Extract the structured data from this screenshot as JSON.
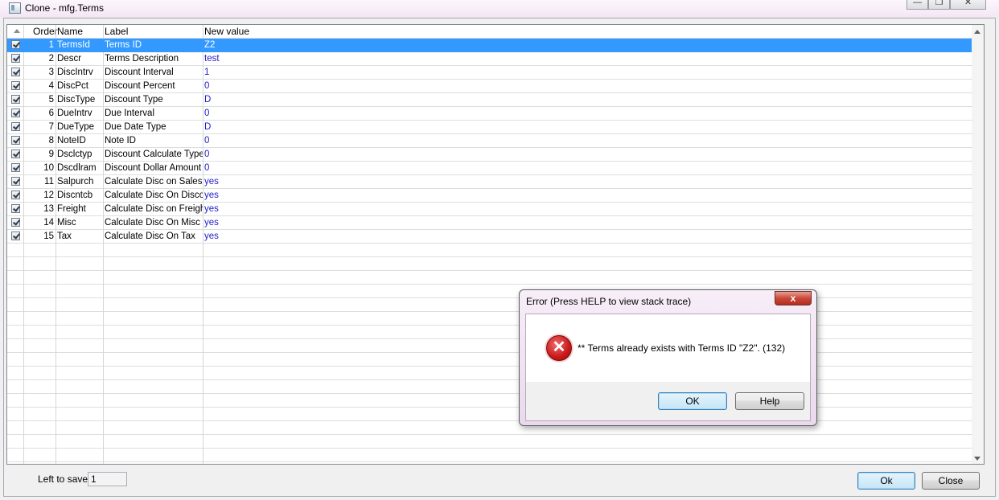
{
  "window": {
    "title": "Clone - mfg.Terms",
    "minimize_glyph": "—",
    "restore_glyph": "❐",
    "close_glyph": "✕"
  },
  "grid": {
    "columns": [
      "Order",
      "Name",
      "Label",
      "New value"
    ],
    "rows": [
      {
        "checked": true,
        "order": "1",
        "name": "TermsId",
        "label": "Terms ID",
        "value": "Z2",
        "selected": true
      },
      {
        "checked": true,
        "order": "2",
        "name": "Descr",
        "label": "Terms Description",
        "value": "test"
      },
      {
        "checked": true,
        "order": "3",
        "name": "DiscIntrv",
        "label": "Discount Interval",
        "value": "1"
      },
      {
        "checked": true,
        "order": "4",
        "name": "DiscPct",
        "label": "Discount Percent",
        "value": "0"
      },
      {
        "checked": true,
        "order": "5",
        "name": "DiscType",
        "label": "Discount Type",
        "value": "D"
      },
      {
        "checked": true,
        "order": "6",
        "name": "DueIntrv",
        "label": "Due Interval",
        "value": "0"
      },
      {
        "checked": true,
        "order": "7",
        "name": "DueType",
        "label": "Due Date Type",
        "value": "D"
      },
      {
        "checked": true,
        "order": "8",
        "name": "NoteID",
        "label": "Note ID",
        "value": "0"
      },
      {
        "checked": true,
        "order": "9",
        "name": "Dsclctyp",
        "label": "Discount Calculate Type",
        "value": "0"
      },
      {
        "checked": true,
        "order": "10",
        "name": "Dscdlram",
        "label": "Discount Dollar Amount",
        "value": "0"
      },
      {
        "checked": true,
        "order": "11",
        "name": "Salpurch",
        "label": "Calculate Disc on Sales",
        "value": "yes"
      },
      {
        "checked": true,
        "order": "12",
        "name": "Discntcb",
        "label": "Calculate Disc On Discou",
        "value": "yes"
      },
      {
        "checked": true,
        "order": "13",
        "name": "Freight",
        "label": "Calculate Disc on Freigh",
        "value": "yes"
      },
      {
        "checked": true,
        "order": "14",
        "name": "Misc",
        "label": "Calculate Disc On Misc",
        "value": "yes"
      },
      {
        "checked": true,
        "order": "15",
        "name": "Tax",
        "label": "Calculate Disc On Tax",
        "value": "yes"
      }
    ]
  },
  "footer": {
    "left_to_save_label": "Left to save:",
    "left_to_save_value": "1",
    "ok_label": "Ok",
    "close_label": "Close"
  },
  "dialog": {
    "title": "Error (Press HELP to view stack trace)",
    "message": "** Terms already exists with Terms ID \"Z2\". (132)",
    "ok_label": "OK",
    "help_label": "Help",
    "close_glyph": "x",
    "icon_glyph": "✕"
  }
}
